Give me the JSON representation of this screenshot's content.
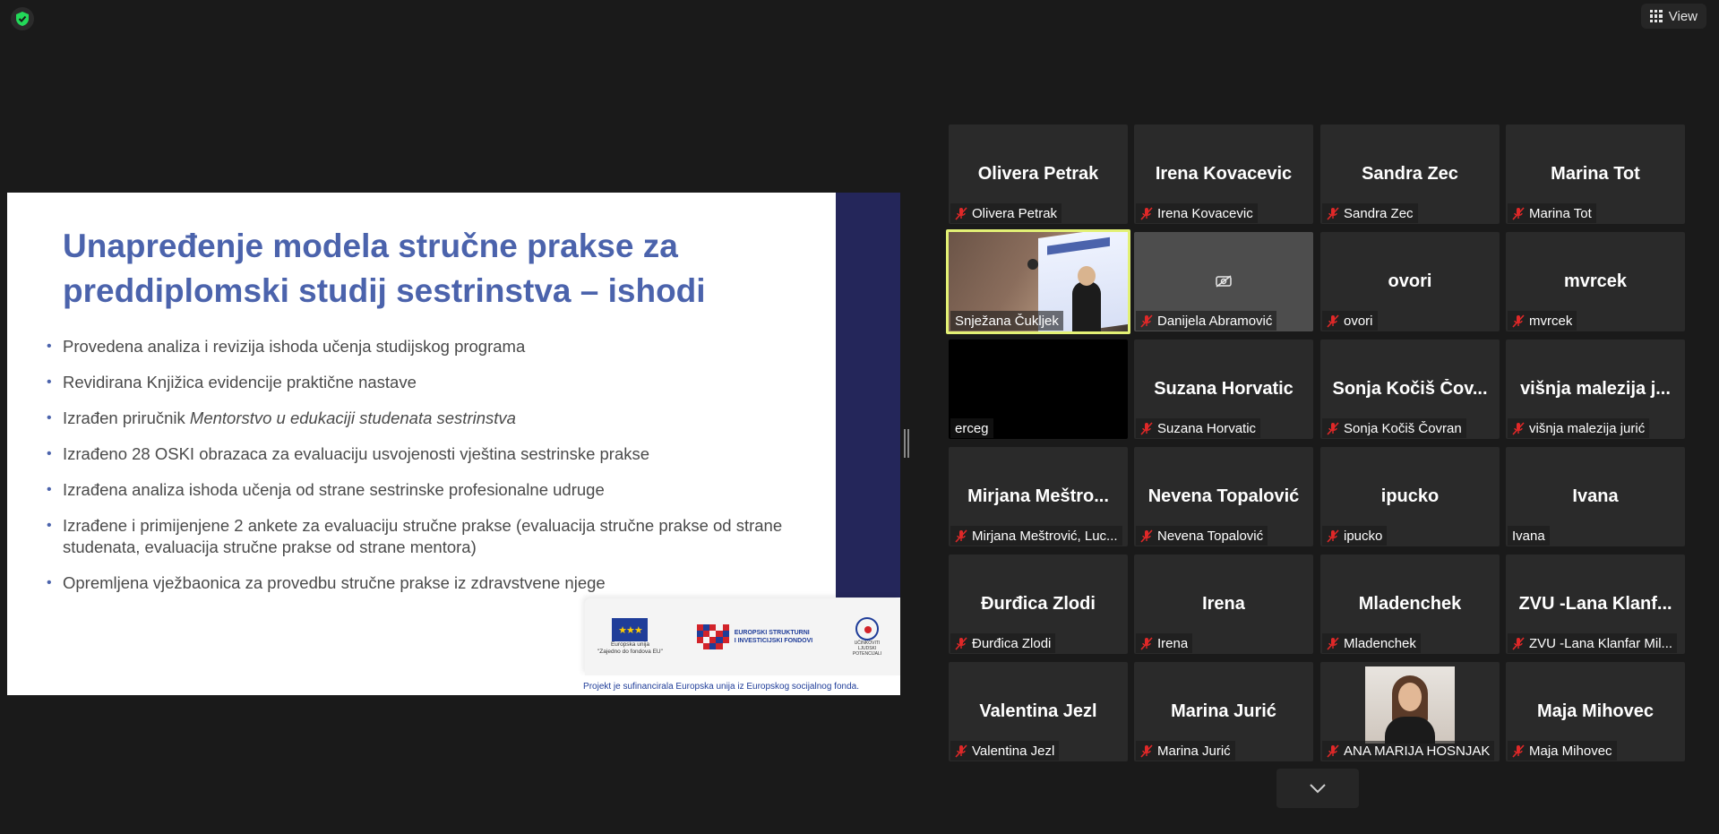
{
  "toolbar": {
    "view_label": "View"
  },
  "slide": {
    "title": "Unapređenje modela stručne prakse za preddiplomski studij sestrinstva – ishodi",
    "bullets": [
      "Provedena analiza i revizija  ishoda učenja studijskog programa",
      "Revidirana Knjižica evidencije praktične nastave",
      "Izrađeno 28 OSKI obrazaca za evaluaciju usvojenosti vještina sestrinske prakse",
      "Izrađena analiza ishoda učenja od strane sestrinske profesionalne udruge",
      "Izrađene i primijenjene 2 ankete za evaluaciju stručne prakse (evaluacija stručne prakse od strane studenata, evaluacija stručne prakse od strane mentora)",
      "Opremljena vježbaonica za provedbu stručne prakse iz zdravstvene njege"
    ],
    "bullet3_prefix": "Izrađen priručnik ",
    "bullet3_italic": "Mentorstvo u edukaciji studenata sestrinstva",
    "eu_caption": "Europska unija\n\"Zajedno do fondova EU\"",
    "esf_line1": "EUROPSKI STRUKTURNI",
    "esf_line2": "I INVESTICIJSKI FONDOVI",
    "partner_caption": "UČINKOVITI LJUDSKI POTENCIJALI",
    "footer": "Projekt je sufinancirala Europska unija iz Europskog socijalnog fonda."
  },
  "participants": [
    {
      "big": "Olivera Petrak",
      "label": "Olivera Petrak",
      "muted": true
    },
    {
      "big": "Irena Kovacevic",
      "label": "Irena Kovacevic",
      "muted": true
    },
    {
      "big": "Sandra Zec",
      "label": "Sandra Zec",
      "muted": true
    },
    {
      "big": "Marina Tot",
      "label": "Marina Tot",
      "muted": true
    },
    {
      "big": "",
      "label": "Snježana Čukljek",
      "muted": false,
      "video": "speaker"
    },
    {
      "big": "",
      "label": "Danijela Abramović",
      "muted": true,
      "video": "camoff"
    },
    {
      "big": "ovori",
      "label": "ovori",
      "muted": true
    },
    {
      "big": "mvrcek",
      "label": "mvrcek",
      "muted": true
    },
    {
      "big": "",
      "label": "erceg",
      "muted": false,
      "video": "black"
    },
    {
      "big": "Suzana Horvatic",
      "label": "Suzana Horvatic",
      "muted": true
    },
    {
      "big": "Sonja Kočiš Čov...",
      "label": "Sonja Kočiš Čovran",
      "muted": true
    },
    {
      "big": "višnja  malezija  j...",
      "label": "višnja malezija jurić",
      "muted": true
    },
    {
      "big": "Mirjana  Meštro...",
      "label": "Mirjana Meštrović, Luc...",
      "muted": true
    },
    {
      "big": "Nevena Topalović",
      "label": "Nevena Topalović",
      "muted": true
    },
    {
      "big": "ipucko",
      "label": "ipucko",
      "muted": true
    },
    {
      "big": "Ivana",
      "label": "Ivana",
      "muted": false
    },
    {
      "big": "Đurđica Zlodi",
      "label": "Đurđica Zlodi",
      "muted": true
    },
    {
      "big": "Irena",
      "label": "Irena",
      "muted": true
    },
    {
      "big": "Mladenchek",
      "label": "Mladenchek",
      "muted": true
    },
    {
      "big": "ZVU -Lana Klanf...",
      "label": "ZVU -Lana Klanfar Mil...",
      "muted": true
    },
    {
      "big": "Valentina Jezl",
      "label": "Valentina Jezl",
      "muted": true
    },
    {
      "big": "Marina Jurić",
      "label": "Marina Jurić",
      "muted": true
    },
    {
      "big": "",
      "label": "ANA MARIJA HOSNJAK",
      "muted": true,
      "video": "photo"
    },
    {
      "big": "Maja Mihovec",
      "label": "Maja Mihovec",
      "muted": true
    }
  ],
  "colors": {
    "accent_active": "#e3f175",
    "slide_title": "#4b63ac",
    "muted_red": "#e02828"
  }
}
